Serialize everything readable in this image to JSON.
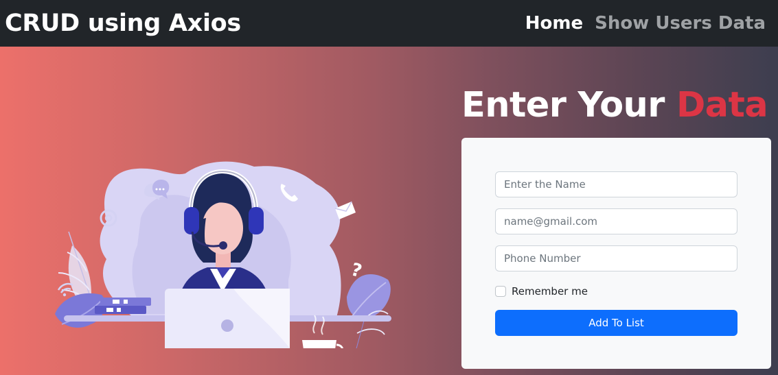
{
  "navbar": {
    "brand": "CRUD using Axios",
    "links": [
      {
        "label": "Home"
      },
      {
        "label": "Show Users Data"
      }
    ]
  },
  "hero": {
    "heading_main": "Enter Your",
    "heading_accent": "Data",
    "accent_color": "#dc3545"
  },
  "form": {
    "name_placeholder": "Enter the Name",
    "email_placeholder": "name@gmail.com",
    "phone_placeholder": "Phone Number",
    "remember_label": "Remember me",
    "submit_label": "Add To List",
    "submit_color": "#0d6efd"
  },
  "illustration": {
    "icons": [
      "chat-bubble-icon",
      "at-sign-icon",
      "phone-icon",
      "envelope-icon",
      "question-mark-icon",
      "wifi-icon"
    ]
  }
}
